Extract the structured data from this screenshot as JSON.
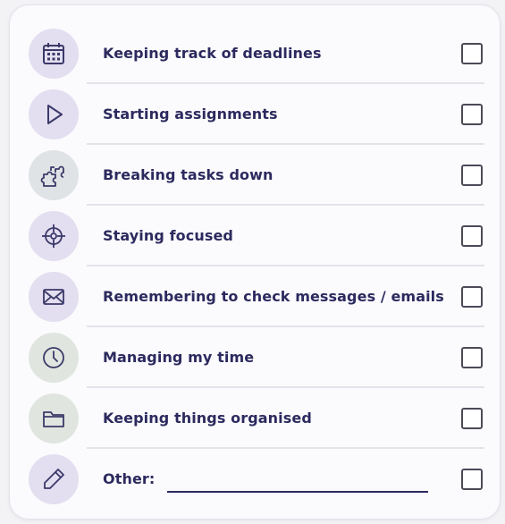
{
  "checklist": {
    "items": [
      {
        "label": "Keeping track of deadlines",
        "icon": "calendar-icon",
        "bg": "#e3def0",
        "checked": false
      },
      {
        "label": "Starting assignments",
        "icon": "play-icon",
        "bg": "#e3def0",
        "checked": false
      },
      {
        "label": "Breaking tasks down",
        "icon": "puzzle-icon",
        "bg": "#e0e3e5",
        "checked": false
      },
      {
        "label": "Staying focused",
        "icon": "target-icon",
        "bg": "#e3def0",
        "checked": false
      },
      {
        "label": "Remembering to check messages / emails",
        "icon": "envelope-icon",
        "bg": "#e3def0",
        "checked": false
      },
      {
        "label": "Managing my time",
        "icon": "clock-icon",
        "bg": "#e0e5df",
        "checked": false
      },
      {
        "label": "Keeping things organised",
        "icon": "folder-icon",
        "bg": "#e0e5df",
        "checked": false
      },
      {
        "label": "Other:",
        "icon": "pencil-icon",
        "bg": "#e3def0",
        "checked": false
      }
    ]
  },
  "colors": {
    "text": "#2c2a5e",
    "icon_stroke": "#3b3968",
    "checkbox_border": "#4a4a58"
  }
}
